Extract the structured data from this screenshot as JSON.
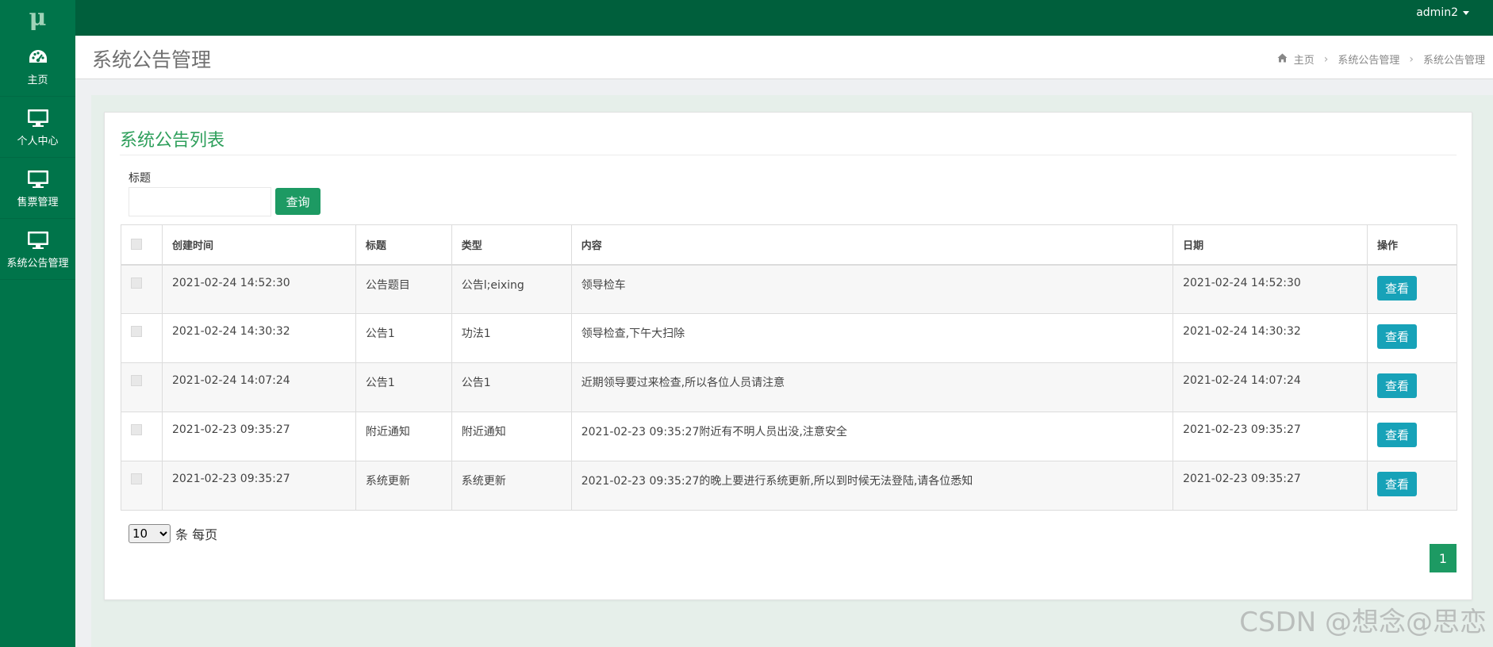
{
  "app": {
    "logo_text": "μ",
    "user": "admin2"
  },
  "sidebar": {
    "items": [
      {
        "label": "主页",
        "icon": "dashboard-icon"
      },
      {
        "label": "个人中心",
        "icon": "monitor-icon"
      },
      {
        "label": "售票管理",
        "icon": "monitor-icon"
      },
      {
        "label": "系统公告管理",
        "icon": "monitor-icon"
      }
    ]
  },
  "header": {
    "title": "系统公告管理",
    "breadcrumb": [
      "主页",
      "系统公告管理",
      "系统公告管理"
    ]
  },
  "panel": {
    "title": "系统公告列表",
    "search": {
      "label": "标题",
      "value": "",
      "button": "查询"
    },
    "table": {
      "columns": [
        "创建时间",
        "标题",
        "类型",
        "内容",
        "日期",
        "操作"
      ],
      "rows": [
        {
          "created": "2021-02-24 14:52:30",
          "title": "公告题目",
          "type": "公告l;eixing",
          "content": "领导检车",
          "date": "2021-02-24 14:52:30",
          "action": "查看"
        },
        {
          "created": "2021-02-24 14:30:32",
          "title": "公告1",
          "type": "功法1",
          "content": "领导检查,下午大扫除",
          "date": "2021-02-24 14:30:32",
          "action": "查看"
        },
        {
          "created": "2021-02-24 14:07:24",
          "title": "公告1",
          "type": "公告1",
          "content": "近期领导要过来检查,所以各位人员请注意",
          "date": "2021-02-24 14:07:24",
          "action": "查看"
        },
        {
          "created": "2021-02-23 09:35:27",
          "title": "附近通知",
          "type": "附近通知",
          "content": "2021-02-23 09:35:27附近有不明人员出没,注意安全",
          "date": "2021-02-23 09:35:27",
          "action": "查看"
        },
        {
          "created": "2021-02-23 09:35:27",
          "title": "系统更新",
          "type": "系统更新",
          "content": "2021-02-23 09:35:27的晚上要进行系统更新,所以到时候无法登陆,请各位悉知",
          "date": "2021-02-23 09:35:27",
          "action": "查看"
        }
      ]
    },
    "pager": {
      "page_size": "10",
      "page_size_suffix": "条 每页",
      "current_page": "1"
    }
  },
  "watermark": "CSDN @想念@思恋",
  "colors": {
    "primary": "#005f3c",
    "sidebar": "#00744a",
    "accent": "#1d9a63",
    "info": "#17a2b8",
    "title_green": "#2e9f5b"
  }
}
